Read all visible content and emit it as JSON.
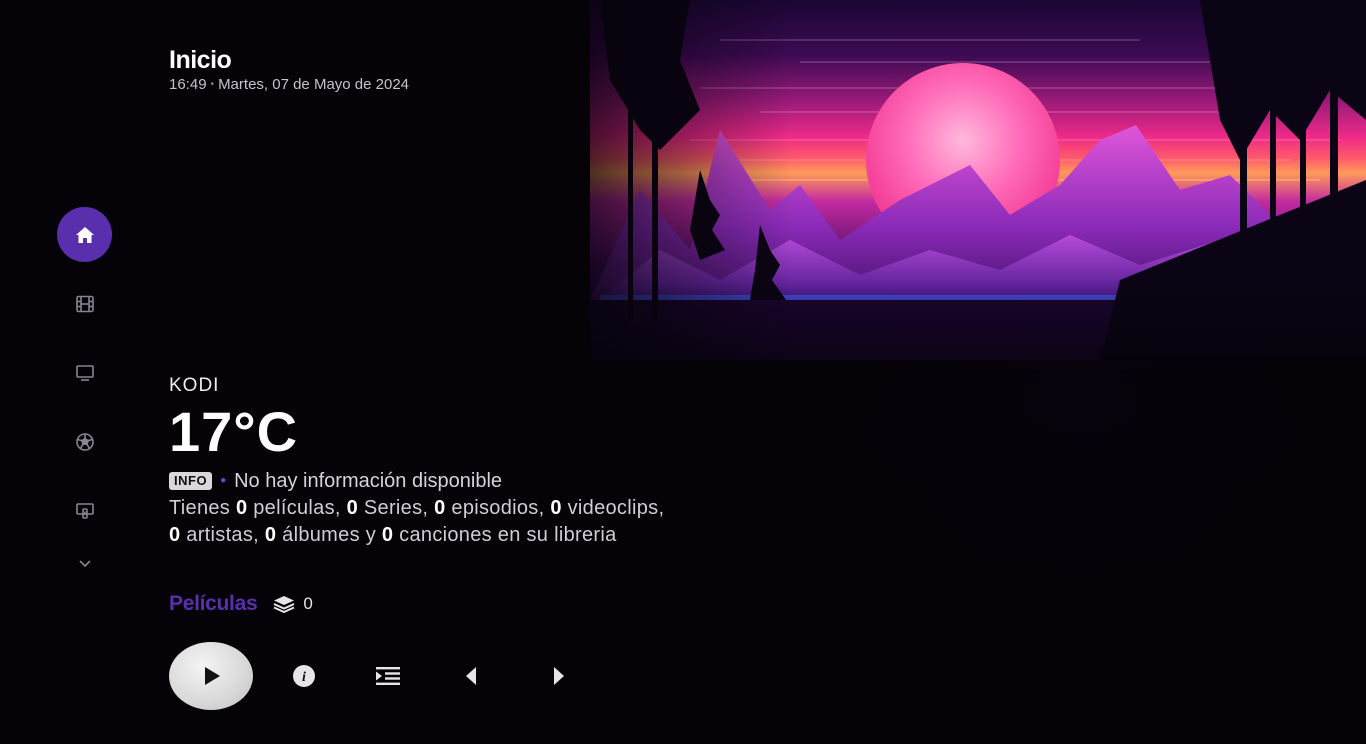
{
  "header": {
    "title": "Inicio",
    "time": "16:49",
    "date": "Martes, 07 de Mayo de 2024"
  },
  "sidebar": {
    "items": [
      {
        "name": "home",
        "icon": "home-icon",
        "active": true
      },
      {
        "name": "movies",
        "icon": "film-icon"
      },
      {
        "name": "tv",
        "icon": "tv-icon"
      },
      {
        "name": "sports",
        "icon": "soccer-ball-icon"
      },
      {
        "name": "addons",
        "icon": "addon-box-icon"
      },
      {
        "name": "more",
        "icon": "chevron-down-icon"
      }
    ]
  },
  "weather": {
    "location": "KODI",
    "temperature": "17°C",
    "badge": "INFO",
    "info_text": "No hay información disponible"
  },
  "library": {
    "t1": "Tienes ",
    "n_movies": "0",
    "t2": " películas, ",
    "n_series": "0",
    "t3": " Series, ",
    "n_episodes": "0",
    "t4": " episodios, ",
    "n_videoclips": "0",
    "t5": " videoclips,",
    "n_artists": "0",
    "t6": " artistas, ",
    "n_albums": "0",
    "t7": " álbumes y ",
    "n_songs": "0",
    "t8": " canciones en su libreria"
  },
  "section": {
    "title": "Películas",
    "count": "0",
    "count_icon": "stack-layers-icon"
  },
  "controls": {
    "play_icon": "play-icon",
    "info_icon": "info-icon",
    "queue_icon": "queue-list-icon",
    "prev_icon": "prev-arrow-icon",
    "next_icon": "next-arrow-icon"
  },
  "colors": {
    "accent": "#5a2fae",
    "background": "#050208"
  }
}
